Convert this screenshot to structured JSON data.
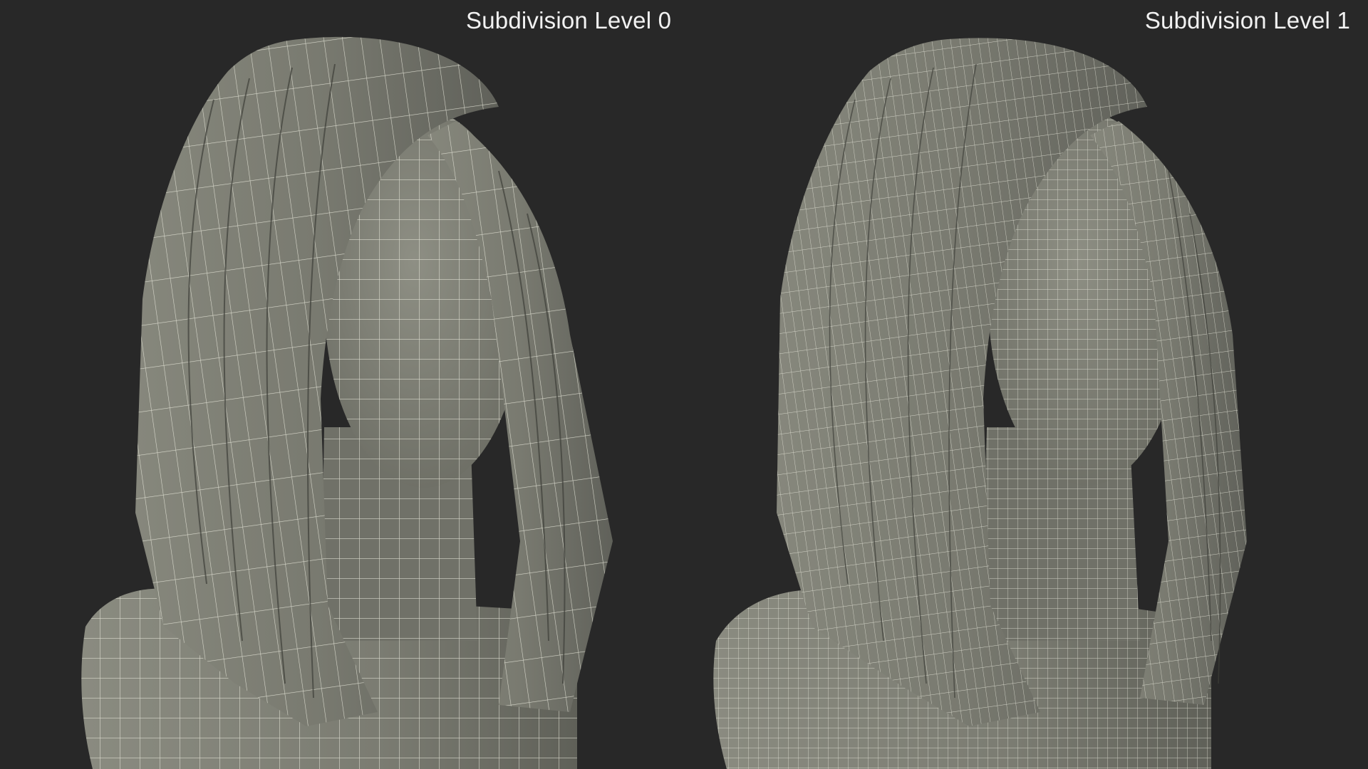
{
  "labels": {
    "left": "Subdivision Level 0",
    "right": "Subdivision Level 1"
  },
  "colors": {
    "background": "#282828",
    "mesh_fill": "#7a7a70",
    "mesh_shadow": "#55564f",
    "wire": "#e9e9dc"
  },
  "panels": [
    {
      "name": "subdivision-level-0",
      "grid_density": "coarse"
    },
    {
      "name": "subdivision-level-1",
      "grid_density": "fine"
    }
  ]
}
